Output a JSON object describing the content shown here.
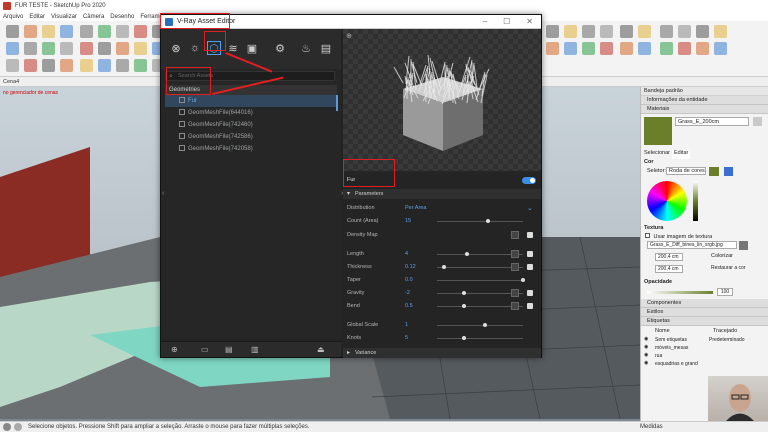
{
  "sketchup": {
    "title": "FUR TESTE - SketchUp Pro 2020",
    "menu": [
      "Arquivo",
      "Editar",
      "Visualizar",
      "Câmera",
      "Desenho",
      "Ferramentas"
    ],
    "scene_tab": "Cena4",
    "viewport_label": "no gerenciador\nde cenas"
  },
  "vray": {
    "title": "V-Ray Asset Editor",
    "search_placeholder": "Search Assets",
    "category": "Geometries",
    "items": [
      {
        "label": "Fur",
        "selected": true
      },
      {
        "label": "GeomMeshFile(644016)",
        "selected": false
      },
      {
        "label": "GeomMeshFile(742460)",
        "selected": false
      },
      {
        "label": "GeomMeshFile(742586)",
        "selected": false
      },
      {
        "label": "GeomMeshFile(742058)",
        "selected": false
      }
    ],
    "asset_name": "Fur",
    "asset_enabled": true,
    "section": "Parameters",
    "section2": "Variance",
    "params": [
      {
        "label": "Distribution",
        "value": "Per Area",
        "kind": "dropdown"
      },
      {
        "label": "Count (Area)",
        "value": "15",
        "kind": "slider",
        "fill": 0.58,
        "tex": false
      },
      {
        "label": "Density Map",
        "value": "",
        "kind": "map",
        "tex": true
      },
      {
        "label": "Length",
        "value": "4",
        "kind": "slider",
        "fill": 0.33,
        "tex": true
      },
      {
        "label": "Thickness",
        "value": "0.12",
        "kind": "slider",
        "fill": 0.06,
        "tex": true
      },
      {
        "label": "Taper",
        "value": "0.0",
        "kind": "slider",
        "fill": 1.0,
        "tex": false
      },
      {
        "label": "Gravity",
        "value": "-2",
        "kind": "slider",
        "fill": 0.3,
        "tex": true
      },
      {
        "label": "Bend",
        "value": "0.5",
        "kind": "slider",
        "fill": 0.3,
        "tex": true
      },
      {
        "label": "Global Scale",
        "value": "1",
        "kind": "slider",
        "fill": 0.55,
        "tex": false
      },
      {
        "label": "Knots",
        "value": "5",
        "kind": "slider",
        "fill": 0.3,
        "tex": false
      }
    ]
  },
  "tray": {
    "title": "Bandeja padrão",
    "entity_info": "Informações da entidade",
    "materials": "Materiais",
    "material_name": "Grass_E_200cm",
    "tab_select": "Selecionar",
    "tab_edit": "Editar",
    "color_label": "Cor",
    "picker_label": "Seletor:",
    "picker_value": "Roda de cores",
    "texture_label": "Textura",
    "use_texture": "Usar imagem de textura",
    "texture_file": "Grass_E_Diff_bines_lin_srgb.jpg",
    "width": "200,4 cm",
    "height": "200,4 cm",
    "colorize": "Colorizar",
    "reset_color": "Restaurar a cor",
    "opacity_label": "Opacidade",
    "opacity_value": "100",
    "components": "Componentes",
    "styles": "Estilos",
    "tags": "Etiquetas",
    "tags_col_name": "Nome",
    "tags_col_dash": "Tracejado",
    "tags_list": [
      "Sem etiquetas",
      "móveis_mesas",
      "rua",
      "esquadrias e grand"
    ],
    "tags_dash_first": "Predeterminado"
  },
  "status": {
    "text": "Selecione objetos. Pressione Shift para ampliar a seleção. Arraste o mouse para fazer múltiplas seleções.",
    "measures_label": "Medidas"
  }
}
